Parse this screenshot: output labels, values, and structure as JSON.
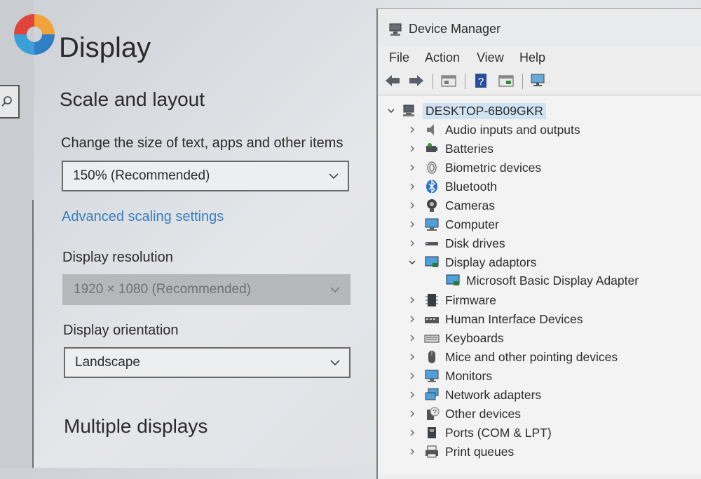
{
  "settings": {
    "page_title": "Display",
    "section_scale": "Scale and layout",
    "scale_label": "Change the size of text, apps and other items",
    "scale_value": "150% (Recommended)",
    "advanced_link": "Advanced scaling settings",
    "resolution_label": "Display resolution",
    "resolution_value": "1920 × 1080 (Recommended)",
    "orientation_label": "Display orientation",
    "orientation_value": "Landscape",
    "section_multiple": "Multiple displays"
  },
  "device_manager": {
    "title": "Device Manager",
    "menu": [
      "File",
      "Action",
      "View",
      "Help"
    ],
    "toolbar_icons": [
      "back-arrow-icon",
      "forward-arrow-icon",
      "properties-icon",
      "help-icon",
      "update-driver-icon",
      "scan-hardware-icon"
    ],
    "root": "DESKTOP-6B09GKR",
    "categories": [
      {
        "label": "Audio inputs and outputs",
        "icon": "speaker-icon",
        "expanded": false
      },
      {
        "label": "Batteries",
        "icon": "battery-icon",
        "expanded": false
      },
      {
        "label": "Biometric devices",
        "icon": "fingerprint-icon",
        "expanded": false
      },
      {
        "label": "Bluetooth",
        "icon": "bluetooth-icon",
        "expanded": false
      },
      {
        "label": "Cameras",
        "icon": "camera-icon",
        "expanded": false
      },
      {
        "label": "Computer",
        "icon": "computer-icon",
        "expanded": false
      },
      {
        "label": "Disk drives",
        "icon": "disk-drive-icon",
        "expanded": false
      },
      {
        "label": "Display adaptors",
        "icon": "display-adapter-icon",
        "expanded": true
      },
      {
        "label": "Microsoft Basic Display Adapter",
        "icon": "display-adapter-icon",
        "child": true
      },
      {
        "label": "Firmware",
        "icon": "firmware-icon",
        "expanded": false
      },
      {
        "label": "Human Interface Devices",
        "icon": "hid-icon",
        "expanded": false
      },
      {
        "label": "Keyboards",
        "icon": "keyboard-icon",
        "expanded": false
      },
      {
        "label": "Mice and other pointing devices",
        "icon": "mouse-icon",
        "expanded": false
      },
      {
        "label": "Monitors",
        "icon": "monitor-icon",
        "expanded": false
      },
      {
        "label": "Network adapters",
        "icon": "network-adapter-icon",
        "expanded": false
      },
      {
        "label": "Other devices",
        "icon": "unknown-device-icon",
        "expanded": false
      },
      {
        "label": "Ports (COM & LPT)",
        "icon": "port-icon",
        "expanded": false
      },
      {
        "label": "Print queues",
        "icon": "printer-icon",
        "expanded": false
      }
    ]
  },
  "colors": {
    "link": "#3a7ec0",
    "root_highlight": "#cfe3f3"
  }
}
